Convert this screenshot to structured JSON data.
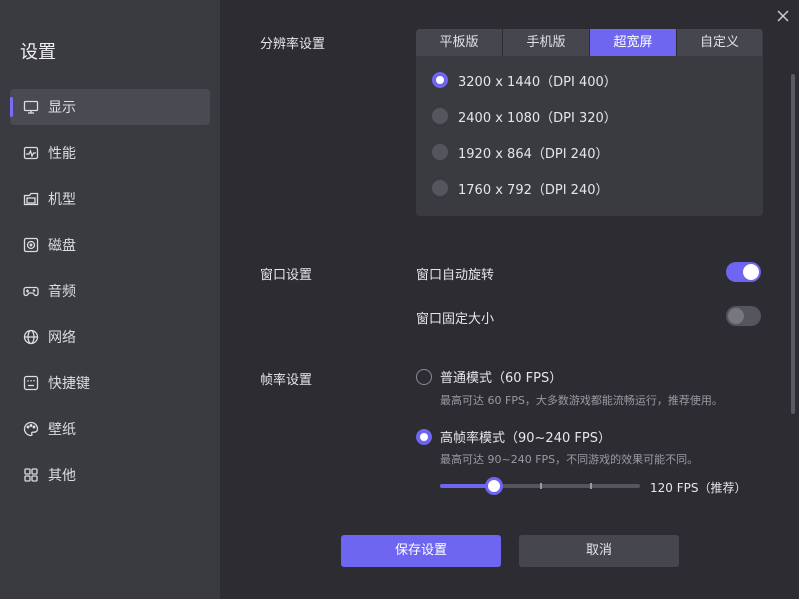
{
  "sidebar": {
    "title": "设置",
    "items": [
      {
        "label": "显示",
        "icon": "monitor-icon"
      },
      {
        "label": "性能",
        "icon": "performance-icon"
      },
      {
        "label": "机型",
        "icon": "device-model-icon"
      },
      {
        "label": "磁盘",
        "icon": "disk-icon"
      },
      {
        "label": "音频",
        "icon": "gamepad-icon"
      },
      {
        "label": "网络",
        "icon": "globe-icon"
      },
      {
        "label": "快捷键",
        "icon": "keyboard-icon"
      },
      {
        "label": "壁纸",
        "icon": "palette-icon"
      },
      {
        "label": "其他",
        "icon": "grid-icon"
      }
    ],
    "active_index": 0
  },
  "resolution": {
    "label": "分辨率设置",
    "tabs": [
      "平板版",
      "手机版",
      "超宽屏",
      "自定义"
    ],
    "active_tab": 2,
    "options": [
      "3200 x 1440（DPI 400）",
      "2400 x 1080（DPI 320）",
      "1920 x 864（DPI 240）",
      "1760 x 792（DPI 240）"
    ],
    "selected_option": 0
  },
  "window": {
    "label": "窗口设置",
    "auto_rotate_label": "窗口自动旋转",
    "auto_rotate": true,
    "fixed_size_label": "窗口固定大小",
    "fixed_size": false
  },
  "framerate": {
    "label": "帧率设置",
    "normal_label": "普通模式（60 FPS）",
    "normal_desc": "最高可达 60 FPS，大多数游戏都能流畅运行，推荐使用。",
    "high_label": "高帧率模式（90~240 FPS）",
    "high_desc": "最高可达 90~240 FPS，不同游戏的效果可能不同。",
    "selected": "high",
    "slider_value_text": "120 FPS（推荐）",
    "slider_fraction": 0.27
  },
  "buttons": {
    "save": "保存设置",
    "cancel": "取消"
  },
  "colors": {
    "accent": "#6e66f0",
    "sidebar_bg": "#3a3a41",
    "content_bg": "#2c2c32"
  }
}
